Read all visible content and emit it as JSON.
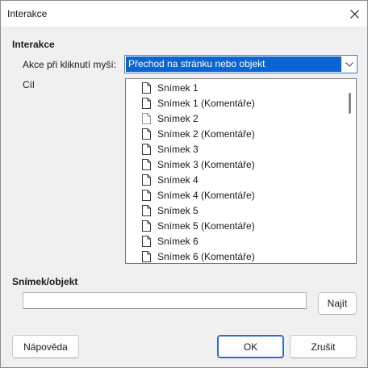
{
  "window": {
    "title": "Interakce"
  },
  "interaction": {
    "section_label": "Interakce",
    "action_label": "Akce při kliknutí myší:",
    "action_value": "Přechod na stránku nebo objekt",
    "target_label": "Cíl",
    "targets": [
      "Snímek 1",
      "Snímek 1 (Komentáře)",
      "Snímek 2",
      "Snímek 2 (Komentáře)",
      "Snímek 3",
      "Snímek 3 (Komentáře)",
      "Snímek 4",
      "Snímek 4 (Komentáře)",
      "Snímek 5",
      "Snímek 5 (Komentáře)",
      "Snímek 6",
      "Snímek 6 (Komentáře)"
    ]
  },
  "slide_object": {
    "section_label": "Snímek/objekt",
    "value": "",
    "find_label": "Najít"
  },
  "buttons": {
    "help": "Nápověda",
    "ok": "OK",
    "cancel": "Zrušit"
  },
  "icons": {
    "close": "close-icon",
    "dropdown": "chevron-down-icon",
    "item": "document-icon"
  }
}
